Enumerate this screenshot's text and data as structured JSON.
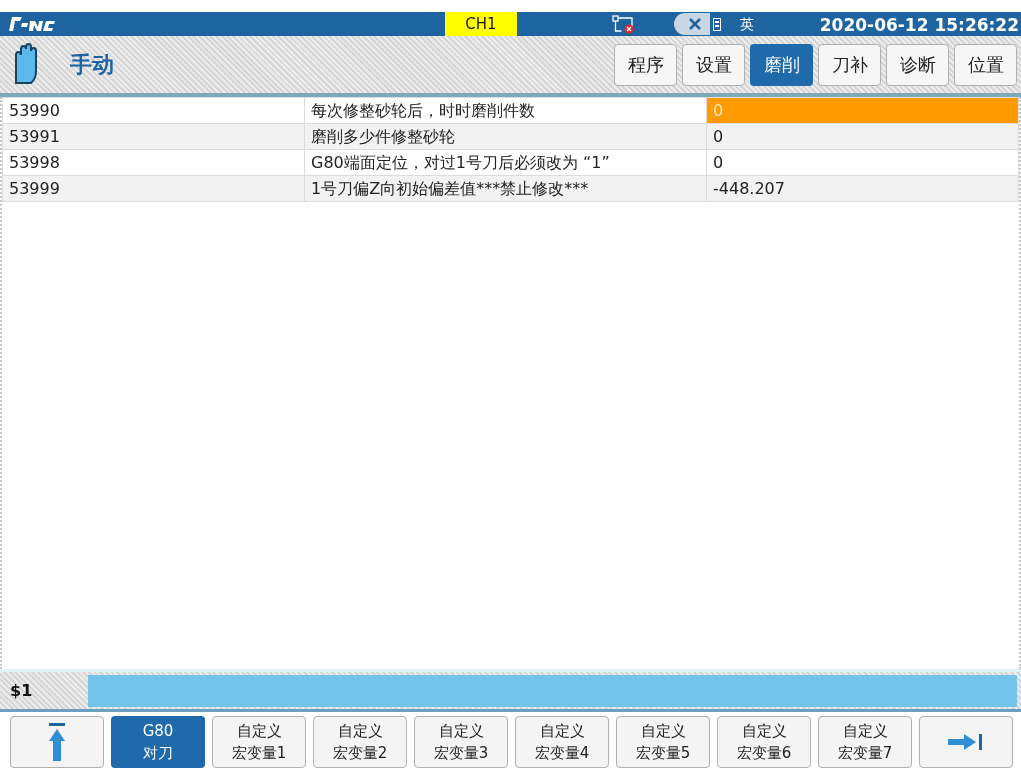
{
  "status_bar": {
    "channel": "CH1",
    "input_method": "英",
    "datetime": "2020-06-12 15:26:22"
  },
  "mode": {
    "label": "手动"
  },
  "tabs": [
    {
      "label": "程序",
      "selected": false
    },
    {
      "label": "设置",
      "selected": false
    },
    {
      "label": "磨削",
      "selected": true
    },
    {
      "label": "刀补",
      "selected": false
    },
    {
      "label": "诊断",
      "selected": false
    },
    {
      "label": "位置",
      "selected": false
    }
  ],
  "table": {
    "rows": [
      {
        "number": "53990",
        "description": "每次修整砂轮后，时时磨削件数",
        "value": "0",
        "selected": true
      },
      {
        "number": "53991",
        "description": "磨削多少件修整砂轮",
        "value": "0",
        "selected": false
      },
      {
        "number": "53998",
        "description": "G80端面定位，对过1号刀后必须改为 “1”",
        "value": "0",
        "selected": false
      },
      {
        "number": "53999",
        "description": "1号刀偏Z向初始偏差值***禁止修改***",
        "value": "-448.207",
        "selected": false
      }
    ]
  },
  "input": {
    "prompt": "$1"
  },
  "softkeys": [
    {
      "kind": "up"
    },
    {
      "kind": "text",
      "lines": [
        "G80",
        "对刀"
      ],
      "selected": true
    },
    {
      "kind": "text",
      "lines": [
        "自定义",
        "宏变量1"
      ],
      "selected": false
    },
    {
      "kind": "text",
      "lines": [
        "自定义",
        "宏变量2"
      ],
      "selected": false
    },
    {
      "kind": "text",
      "lines": [
        "自定义",
        "宏变量3"
      ],
      "selected": false
    },
    {
      "kind": "text",
      "lines": [
        "自定义",
        "宏变量4"
      ],
      "selected": false
    },
    {
      "kind": "text",
      "lines": [
        "自定义",
        "宏变量5"
      ],
      "selected": false
    },
    {
      "kind": "text",
      "lines": [
        "自定义",
        "宏变量6"
      ],
      "selected": false
    },
    {
      "kind": "text",
      "lines": [
        "自定义",
        "宏变量7"
      ],
      "selected": false
    },
    {
      "kind": "next"
    }
  ]
}
